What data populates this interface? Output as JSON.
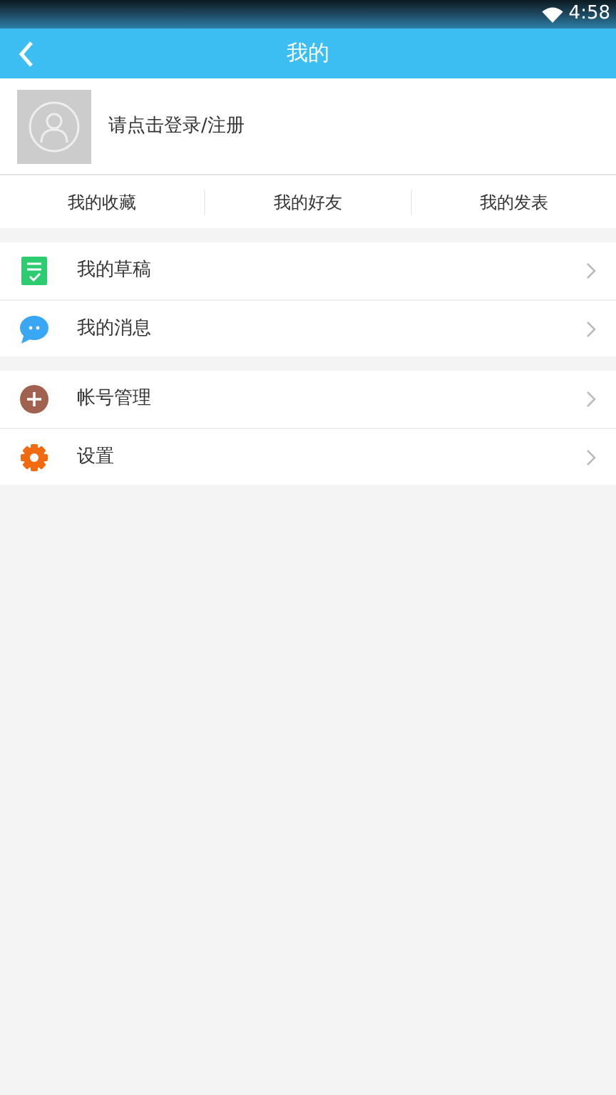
{
  "status_bar": {
    "time": "4:58"
  },
  "header": {
    "title": "我的"
  },
  "profile": {
    "login_prompt": "请点击登录/注册"
  },
  "tabs": [
    {
      "label": "我的收藏"
    },
    {
      "label": "我的好友"
    },
    {
      "label": "我的发表"
    }
  ],
  "menu_groups": [
    {
      "items": [
        {
          "kind": "drafts",
          "label": "我的草稿"
        },
        {
          "kind": "messages",
          "label": "我的消息"
        }
      ]
    },
    {
      "items": [
        {
          "kind": "account",
          "label": "帐号管理"
        },
        {
          "kind": "settings",
          "label": "设置"
        }
      ]
    }
  ]
}
